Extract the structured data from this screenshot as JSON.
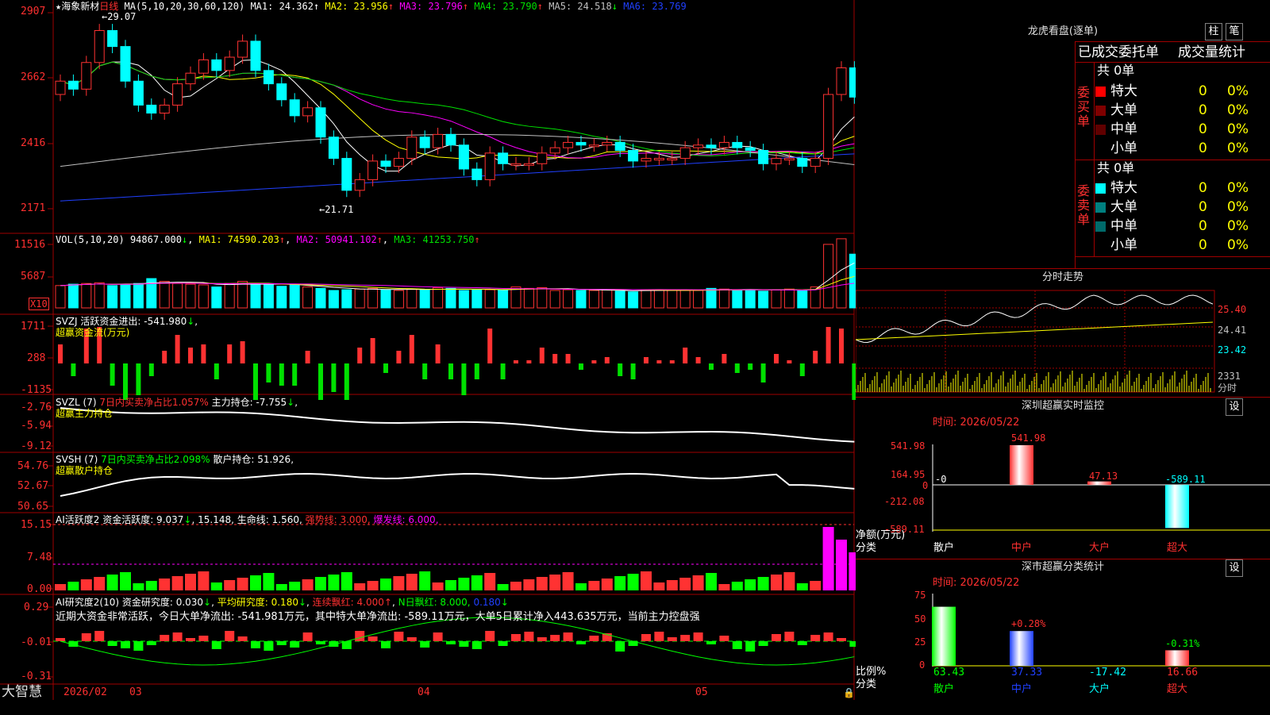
{
  "colors": {
    "up": "#ff3232",
    "down": "#00ffff",
    "ma1": "#ffffff",
    "ma2": "#ffff00",
    "ma3": "#ff00ff",
    "ma4": "#00e000",
    "ma5": "#c0c0c0",
    "ma6": "#2040ff",
    "grid": "#a00000"
  },
  "kline": {
    "title": "海象新材",
    "period": "日线",
    "ma_params": "MA(5,10,20,30,60,120)",
    "ma": [
      {
        "label": "MA1: 24.362",
        "arrow": "↑"
      },
      {
        "label": "MA2: 23.956",
        "arrow": "↑"
      },
      {
        "label": "MA3: 23.796",
        "arrow": "↑"
      },
      {
        "label": "MA4: 23.790",
        "arrow": "↑"
      },
      {
        "label": "MA5: 24.518",
        "arrow": "↓"
      },
      {
        "label": "MA6: 23.769",
        "arrow": ""
      }
    ],
    "y_ticks": [
      "2907",
      "2662",
      "2416",
      "2171"
    ],
    "high_mark": "29.07",
    "low_mark": "21.71",
    "closes": [
      26.5,
      26.2,
      27.2,
      28.4,
      27.8,
      26.5,
      25.6,
      25.3,
      25.6,
      26.4,
      26.8,
      27.3,
      26.9,
      27.4,
      28.0,
      26.9,
      26.4,
      25.8,
      25.2,
      25.5,
      24.4,
      23.6,
      22.4,
      22.8,
      23.5,
      23.3,
      23.6,
      24.4,
      24.0,
      24.5,
      24.1,
      23.2,
      22.8,
      23.8,
      23.4,
      23.4,
      23.4,
      23.8,
      24.0,
      24.2,
      24.1,
      24.1,
      24.2,
      23.9,
      23.5,
      23.6,
      23.6,
      23.6,
      24.0,
      24.1,
      24.0,
      24.2,
      24.0,
      23.9,
      23.4,
      23.6,
      23.6,
      23.3,
      23.6,
      26.0,
      27.0,
      25.9
    ],
    "opens": [
      26.0,
      26.5,
      26.2,
      27.2,
      28.4,
      27.8,
      26.5,
      25.6,
      25.3,
      25.6,
      26.4,
      26.8,
      27.3,
      26.9,
      27.4,
      28.0,
      26.9,
      26.4,
      25.8,
      25.2,
      25.5,
      24.4,
      23.6,
      22.4,
      22.8,
      23.5,
      23.3,
      23.6,
      24.4,
      24.0,
      24.5,
      24.1,
      23.2,
      22.8,
      23.8,
      23.4,
      23.4,
      23.4,
      23.8,
      24.0,
      24.2,
      24.1,
      24.1,
      24.2,
      23.9,
      23.5,
      23.6,
      23.6,
      23.6,
      24.0,
      24.1,
      24.0,
      24.2,
      24.0,
      23.9,
      23.4,
      23.6,
      23.6,
      23.3,
      23.6,
      26.0,
      27.0
    ]
  },
  "vol": {
    "header": "VOL(5,10,20)",
    "value": "94867.000",
    "value_arrow": "↓",
    "ma": [
      {
        "label": "MA1: 74590.203",
        "arrow": "↑"
      },
      {
        "label": "MA2: 50941.102",
        "arrow": "↑"
      },
      {
        "label": "MA3: 41253.750",
        "arrow": "↑"
      }
    ],
    "y_ticks": [
      "11516",
      "5687"
    ],
    "unit": "X10",
    "values": [
      3.2,
      3.4,
      3.5,
      3.6,
      3.2,
      3.4,
      3.5,
      4.2,
      3.8,
      3.5,
      3.4,
      3.3,
      3.0,
      3.5,
      3.8,
      3.4,
      3.3,
      3.1,
      3.3,
      3.0,
      2.8,
      2.5,
      2.6,
      2.7,
      2.8,
      2.6,
      2.5,
      2.7,
      2.6,
      2.9,
      2.8,
      2.5,
      2.6,
      2.6,
      2.5,
      3.0,
      2.8,
      2.9,
      2.5,
      2.6,
      2.5,
      2.5,
      2.6,
      2.4,
      2.3,
      2.6,
      2.6,
      2.6,
      2.5,
      2.5,
      2.8,
      2.7,
      2.6,
      2.6,
      2.4,
      2.6,
      2.7,
      2.5,
      3.0,
      9.1,
      9.9,
      7.7
    ]
  },
  "svzj": {
    "header": "SVZJ  活跃资金进出: -541.980",
    "arrow": "↓",
    "sub": "超赢资金流(万元)",
    "y_ticks": [
      "1711",
      "288",
      "-1135"
    ]
  },
  "svzl": {
    "header_a": "SVZL (7)",
    "header_b": "7日内买卖净占比1.057%",
    "header_c": "主力持仓: -7.755",
    "arrow": "↓",
    "sub": "超赢主力持仓",
    "y_ticks": [
      "-2.76",
      "-5.94",
      "-9.12"
    ]
  },
  "svsh": {
    "header_a": "SVSH (7)",
    "header_b": "7日内买卖净占比2.098%",
    "header_c": "散户持仓: 51.926,",
    "sub": "超赢散户持仓",
    "y_ticks": [
      "54.76",
      "52.67",
      "50.65"
    ]
  },
  "ai1": {
    "header": "AI活跃度2 资金活跃度: 9.037",
    "arrow1": "↓",
    "v2": "15.148,",
    "v3": "生命线: 1.560,",
    "v4": "强势线: 3.000,",
    "v5": "爆发线: 6.000,",
    "y_ticks": [
      "15.15",
      "7.48",
      "0.00"
    ]
  },
  "ai2": {
    "header": "AI研究度2(10) 资金研究度: 0.030",
    "arrow1": "↓",
    "v2": "平均研究度: 0.180",
    "arrow2": "↓",
    "v3": "连续飘红: 4.000",
    "arrow3": "↑",
    "v4": "N日飘红: 8.000,",
    "v5": "0.180",
    "arrow5": "↓",
    "summary": "近期大资金非常活跃，今日大单净流出: -541.981万元，其中特大单净流出: -589.11万元，大单5日累计净入443.635万元，当前主力控盘强",
    "y_ticks": [
      "0.29",
      "-0.01",
      "-0.31"
    ]
  },
  "x_axis": {
    "labels": [
      "2026/02",
      "03",
      "04",
      "05"
    ]
  },
  "brand": "大智慧",
  "lhb": {
    "title": "龙虎看盘(逐单)",
    "btn1": "柱",
    "btn2": "笔",
    "tabs": [
      "已成交委托单",
      "成交量统计"
    ],
    "buy": {
      "side": "委买单",
      "total": "共 0单",
      "rows": [
        {
          "name": "特大",
          "v": "0",
          "p": "0%",
          "c": "#ff0000"
        },
        {
          "name": "大单",
          "v": "0",
          "p": "0%",
          "c": "#800000"
        },
        {
          "name": "中单",
          "v": "0",
          "p": "0%",
          "c": "#600000"
        },
        {
          "name": "小单",
          "v": "0",
          "p": "0%",
          "c": ""
        }
      ]
    },
    "sell": {
      "side": "委卖单",
      "total": "共 0单",
      "rows": [
        {
          "name": "特大",
          "v": "0",
          "p": "0%",
          "c": "#00ffff"
        },
        {
          "name": "大单",
          "v": "0",
          "p": "0%",
          "c": "#008080"
        },
        {
          "name": "中单",
          "v": "0",
          "p": "0%",
          "c": "#006a6a"
        },
        {
          "name": "小单",
          "v": "0",
          "p": "0%",
          "c": ""
        }
      ]
    }
  },
  "fenshi": {
    "title": "分时走势",
    "y_ticks": [
      "25.40",
      "24.41",
      "23.42"
    ],
    "vol_tick": "2331",
    "vol_label": "分时"
  },
  "szmon": {
    "title": "深圳超赢实时监控",
    "btn": "设",
    "time": "时间: 2026/05/22",
    "y_ticks": [
      "541.98",
      "164.95",
      "0",
      "-212.08",
      "-589.11"
    ],
    "y_label1": "净额(万元)",
    "y_label2": "分类",
    "cats": [
      "散户",
      "中户",
      "大户",
      "超大"
    ],
    "values": [
      "-0",
      "541.98",
      "47.13",
      "-589.11"
    ]
  },
  "szstat": {
    "title": "深市超赢分类统计",
    "btn": "设",
    "time": "时间: 2026/05/22",
    "y_ticks": [
      "75",
      "50",
      "25",
      "0"
    ],
    "y_label1": "比例%",
    "y_label2": "分类",
    "cats": [
      "散户",
      "中户",
      "大户",
      "超大"
    ],
    "values": [
      "63.43",
      "37.33",
      "-17.42",
      "16.66"
    ],
    "deltas": [
      "",
      "+0.28%",
      "",
      "-0.31%"
    ]
  }
}
